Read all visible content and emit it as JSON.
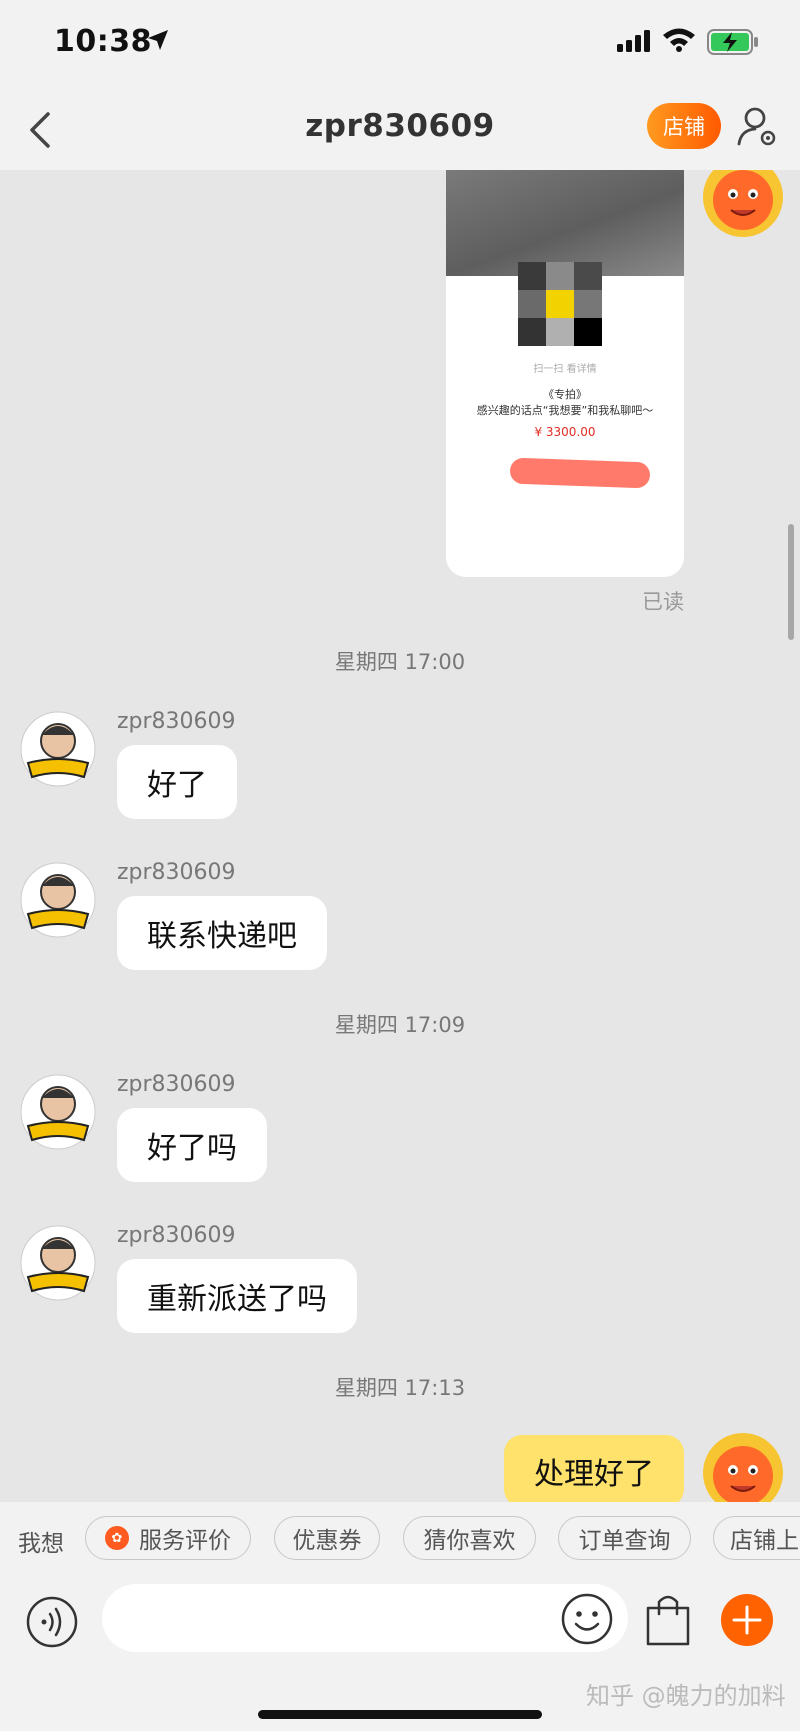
{
  "status": {
    "time": "10:38"
  },
  "nav": {
    "title": "zpr830609",
    "shop_label": "店铺"
  },
  "product_card": {
    "scan_text": "扫一扫  看详情",
    "title": "《专拍》",
    "subtitle": "感兴趣的话点“我想要”和我私聊吧～",
    "price": "¥ 3300.00"
  },
  "read_receipt": "已读",
  "timestamps": [
    "星期四 17:00",
    "星期四 17:09",
    "星期四 17:13"
  ],
  "messages": [
    {
      "sender": "zpr830609",
      "text": "好了"
    },
    {
      "sender": "zpr830609",
      "text": "联系快递吧"
    },
    {
      "sender": "zpr830609",
      "text": "好了吗"
    },
    {
      "sender": "zpr830609",
      "text": "重新派送了吗"
    }
  ],
  "my_message": "处理好了",
  "quickbar": {
    "label": "我想",
    "chips": [
      "服务评价",
      "优惠券",
      "猜你喜欢",
      "订单查询",
      "店铺上新"
    ]
  },
  "input": {
    "placeholder": ""
  },
  "watermark": "知乎 @魄力的加料",
  "colors": {
    "accent": "#ff5a00",
    "my_bubble": "#ffe26b",
    "price": "#e02e24"
  }
}
